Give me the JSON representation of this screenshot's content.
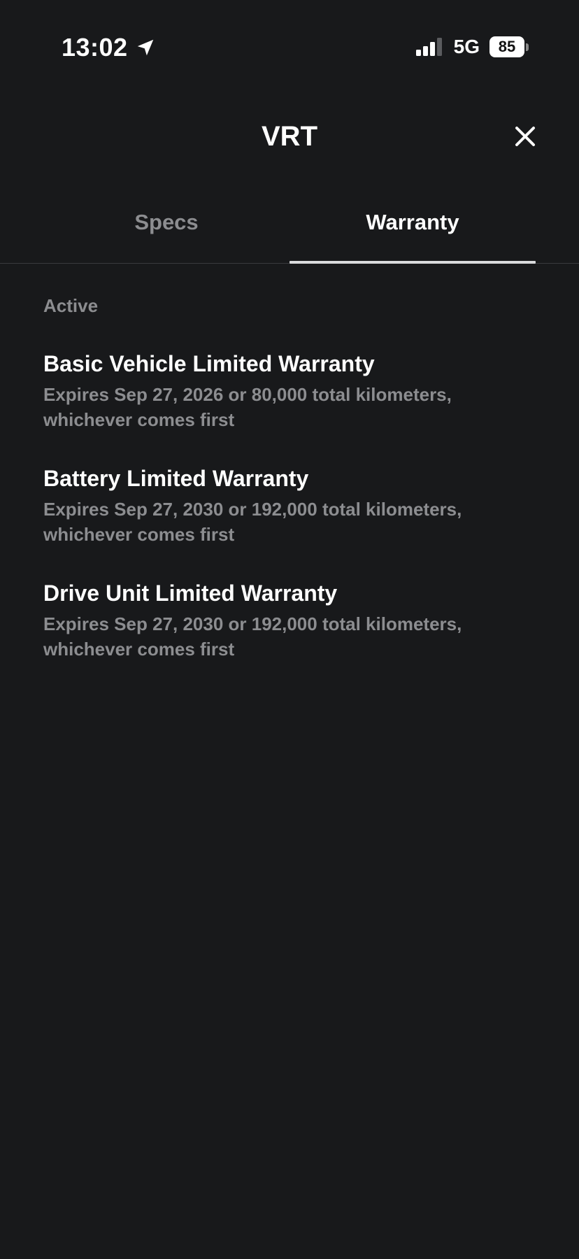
{
  "status_bar": {
    "time": "13:02",
    "network": "5G",
    "battery": "85",
    "icons": [
      "location-arrow-icon",
      "signal-bars-icon",
      "battery-icon"
    ]
  },
  "header": {
    "title": "VRT",
    "close_icon": "close-icon"
  },
  "tabs": [
    {
      "label": "Specs",
      "active": false
    },
    {
      "label": "Warranty",
      "active": true
    }
  ],
  "section": {
    "label": "Active"
  },
  "warranties": [
    {
      "title": "Basic Vehicle Limited Warranty",
      "description": "Expires Sep 27, 2026 or 80,000 total kilometers, whichever comes first"
    },
    {
      "title": "Battery Limited Warranty",
      "description": "Expires Sep 27, 2030 or 192,000 total kilometers, whichever comes first"
    },
    {
      "title": "Drive Unit Limited Warranty",
      "description": "Expires Sep 27, 2030 or 192,000 total kilometers, whichever comes first"
    }
  ],
  "colors": {
    "background": "#18191b",
    "primary_text": "#ffffff",
    "secondary_text": "#8c8d90",
    "tab_indicator": "#d9dadc"
  }
}
